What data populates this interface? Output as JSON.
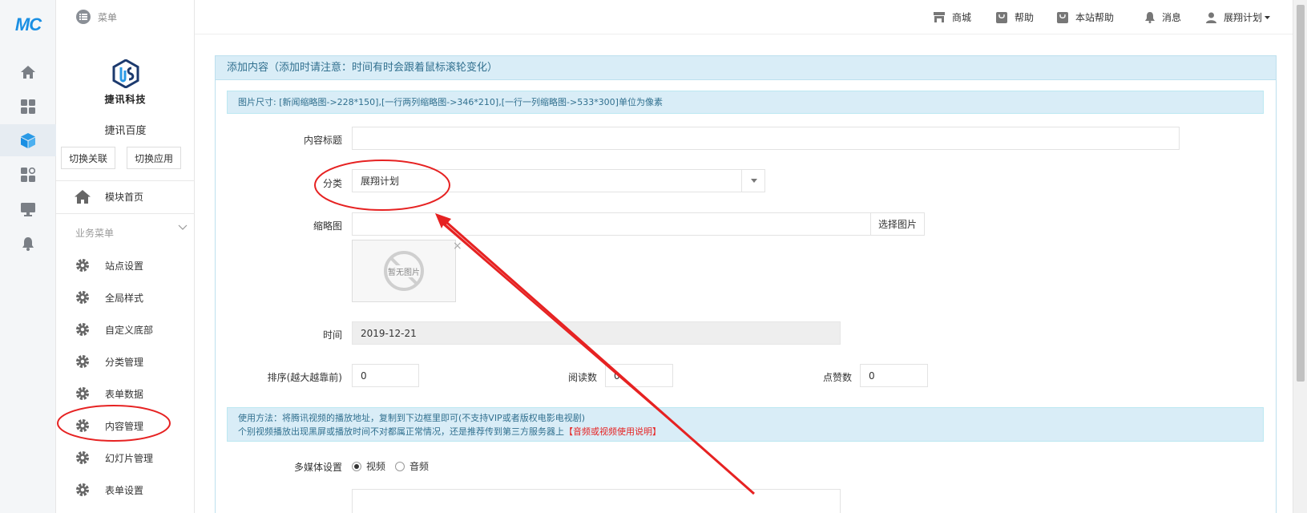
{
  "rail": {
    "logo": "MC"
  },
  "sidebar": {
    "brand_text": "捷讯科技",
    "site_name": "捷讯百度",
    "switch_link": "切换关联",
    "switch_app": "切换应用",
    "home": "模块首页",
    "section_title": "业务菜单",
    "items": [
      "站点设置",
      "全局样式",
      "自定义底部",
      "分类管理",
      "表单数据",
      "内容管理",
      "幻灯片管理",
      "表单设置"
    ]
  },
  "topbar": {
    "menu": "菜单",
    "mall": "商城",
    "help": "帮助",
    "site_help": "本站帮助",
    "messages": "消息",
    "user": "展翔计划"
  },
  "panel": {
    "title": "添加内容（添加时请注意：时间有时会跟着鼠标滚轮变化）",
    "img_hint": "图片尺寸: [新闻缩略图->228*150],[一行两列缩略图->346*210],[一行一列缩略图->533*300]单位为像素"
  },
  "form": {
    "title_label": "内容标题",
    "title_value": "",
    "category_label": "分类",
    "category_value": "展翔计划",
    "thumb_label": "缩略图",
    "pick_image": "选择图片",
    "no_image": "暂无图片",
    "close": "×",
    "time_label": "时间",
    "time_value": "2019-12-21",
    "order_label": "排序(越大越靠前)",
    "order_value": "0",
    "reads_label": "阅读数",
    "reads_value": "0",
    "likes_label": "点赞数",
    "likes_value": "0",
    "usage_line1": "使用方法：将腾讯视频的播放地址，复制到下边框里即可(不支持VIP或者版权电影电视剧)",
    "usage_line2": "个别视频播放出现黑屏或播放时间不对都属正常情况，还是推荐传到第三方服务器上",
    "usage_link": "【音频或视频使用说明】",
    "media_label": "多媒体设置",
    "media_video": "视频",
    "media_audio": "音频"
  },
  "colors": {
    "accent": "#1a8fe3",
    "annotation": "#e62222",
    "info_bg": "#d9edf7",
    "info_text": "#31708f"
  }
}
